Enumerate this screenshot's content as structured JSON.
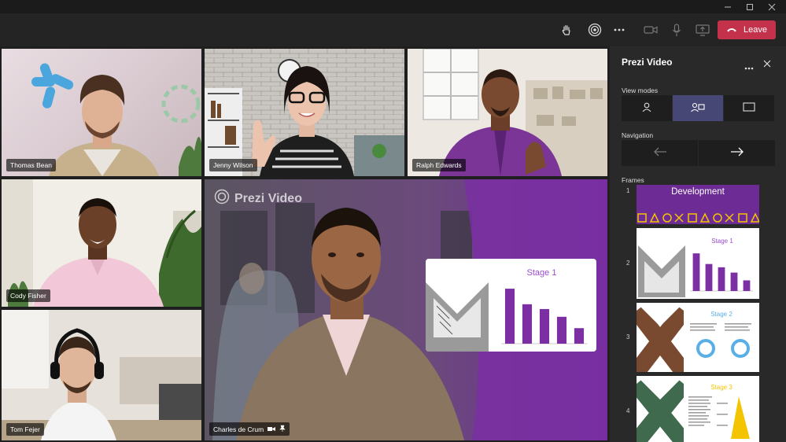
{
  "toolbar": {
    "leave_label": "Leave",
    "icons": [
      "raise-hand",
      "prezi-app",
      "more-options",
      "camera",
      "microphone",
      "share-screen",
      "leave-call"
    ]
  },
  "participants": [
    {
      "name": "Thomas Bean"
    },
    {
      "name": "Jenny Wilson"
    },
    {
      "name": "Ralph Edwards"
    },
    {
      "name": "Cody Fisher"
    },
    {
      "name": "Tom Fejer"
    },
    {
      "name": "Charles de Crum"
    }
  ],
  "main_stage": {
    "watermark": "Prezi Video",
    "overlay_card": {
      "title": "Stage 1",
      "bars": [
        92,
        66,
        58,
        45,
        26
      ]
    }
  },
  "panel": {
    "title": "Prezi Video",
    "view_modes_label": "View modes",
    "navigation_label": "Navigation",
    "frames_label": "Frames",
    "frames": [
      {
        "number": "1",
        "title": "Development"
      },
      {
        "number": "2",
        "title": "Stage 1"
      },
      {
        "number": "3",
        "title": "Stage 2"
      },
      {
        "number": "4",
        "title": "Stage 3"
      }
    ]
  },
  "colors": {
    "accent_purple": "#7b2fa3",
    "leave_red": "#c4314b",
    "active_mode": "#464775",
    "stage2_blue": "#5ab0e6",
    "stage3_yellow": "#f5c400"
  }
}
